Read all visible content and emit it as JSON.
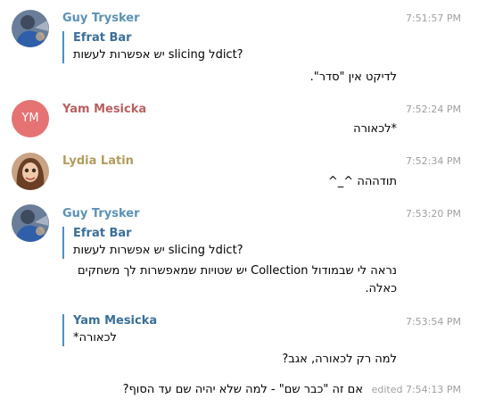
{
  "colors": {
    "name_guy": "#5b92b5",
    "name_yam": "#b86060",
    "name_lydia": "#b29c5c",
    "reply_bar": "#4a90c0",
    "reply_name": "#3a6f9a",
    "time": "#a0a0a0",
    "avatar_ym_bg": "#e57373"
  },
  "messages": [
    {
      "author": "Guy Trysker",
      "avatar": "photo",
      "time": "7:51:57 PM",
      "reply": {
        "author": "Efrat Bar",
        "text": "יש אפשרות לעשות slicing לdict?"
      },
      "text": "לדיקט אין \"סדר\"."
    },
    {
      "author": "Yam Mesicka",
      "avatar_initials": "YM",
      "time": "7:52:24 PM",
      "text": "*לכאורה"
    },
    {
      "author": "Lydia Latin",
      "avatar": "photo",
      "time": "7:52:34 PM",
      "text": "תודההה ^_^"
    },
    {
      "author": "Guy Trysker",
      "avatar": "photo",
      "time": "7:53:20 PM",
      "reply": {
        "author": "Efrat Bar",
        "text": "יש אפשרות לעשות slicing לdict?"
      },
      "text": "נראה לי שבמודול Collection יש שטויות שמאפשרות לך משחקים כאלה."
    },
    {
      "time": "7:53:54 PM",
      "reply": {
        "author": "Yam Mesicka",
        "text": "*לכאורה"
      },
      "text": "למה רק לכאורה, אגב?"
    },
    {
      "time": "edited 7:54:13 PM",
      "text": "אם זה \"כבר שם\" - למה שלא יהיה שם עד הסוף?"
    }
  ]
}
